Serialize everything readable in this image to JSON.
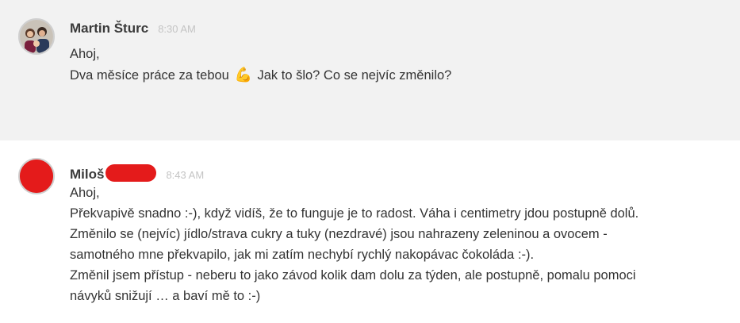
{
  "messages": [
    {
      "author": "Martin Šturc",
      "time": "8:30 AM",
      "lines": [
        "Ahoj,",
        "Dva měsíce práce za tebou",
        "Jak to šlo? Co se nejvíc změnilo?"
      ],
      "emoji": "💪",
      "emoji_name": "flexed-biceps-icon",
      "background": "#f2f2f2"
    },
    {
      "author": "Miloš",
      "time": "8:43 AM",
      "redaction_color": "#e41b1b",
      "lines": [
        "Ahoj,",
        "Překvapivě snadno :-), když vidíš, že to funguje je to radost. Váha i centimetry jdou postupně dolů.",
        "Změnilo se (nejvíc) jídlo/strava cukry a tuky (nezdravé) jsou nahrazeny zeleninou a ovocem -",
        "samotného mne překvapilo, jak mi zatím nechybí rychlý nakopávac čokoláda :-).",
        "Změnil jsem přístup - neberu to jako závod kolik dam dolu za týden, ale postupně, pomalu pomoci",
        "návyků snižují … a baví mě to :-)"
      ],
      "background": "#ffffff"
    }
  ]
}
